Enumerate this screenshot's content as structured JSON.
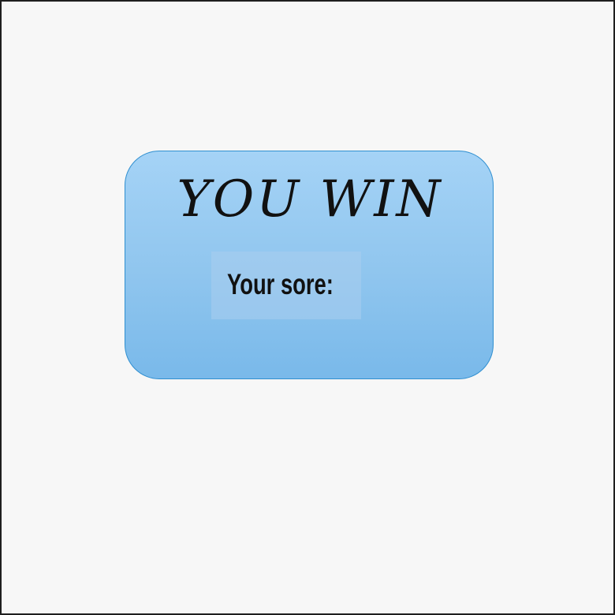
{
  "win_screen": {
    "title": "YOU WIN",
    "score_label": "Your sore:",
    "score_value": ""
  },
  "colors": {
    "background": "#f7f7f7",
    "border": "#1f1f1f",
    "card_top": "#a5d3f6",
    "card_bottom": "#79b9ea",
    "card_outline": "#2f8fd0",
    "text": "#111111"
  }
}
